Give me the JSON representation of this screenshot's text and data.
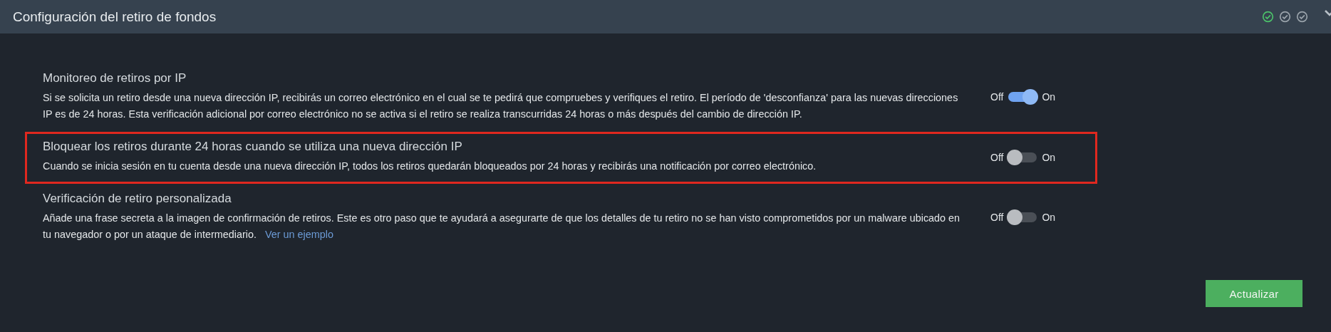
{
  "header": {
    "title": "Configuración del retiro de fondos",
    "steps": [
      {
        "complete": true
      },
      {
        "complete": false
      },
      {
        "complete": false
      }
    ]
  },
  "settings": [
    {
      "title": "Monitoreo de retiros por IP",
      "description": "Si se solicita un retiro desde una nueva dirección IP, recibirás un correo electrónico en el cual se te pedirá que compruebes y verifiques el retiro. El período de 'desconfianza' para las nuevas direcciones IP es de 24 horas. Esta verificación adicional por correo electrónico no se activa si el retiro se realiza transcurridas 24 horas o más después del cambio de dirección IP.",
      "off_label": "Off",
      "on_label": "On",
      "on": true,
      "highlighted": false
    },
    {
      "title": "Bloquear los retiros durante 24 horas cuando se utiliza una nueva dirección IP",
      "description": "Cuando se inicia sesión en tu cuenta desde una nueva dirección IP, todos los retiros quedarán bloqueados por 24 horas y recibirás una notificación por correo electrónico.",
      "off_label": "Off",
      "on_label": "On",
      "on": false,
      "highlighted": true
    },
    {
      "title": "Verificación de retiro personalizada",
      "description": "Añade una frase secreta a la imagen de confirmación de retiros. Este es otro paso que te ayudará a asegurarte de que los detalles de tu retiro no se han visto comprometidos por un malware ubicado en tu navegador o por un ataque de intermediario.",
      "link": "Ver un ejemplo",
      "off_label": "Off",
      "on_label": "On",
      "on": false,
      "highlighted": false
    }
  ],
  "submit": "Actualizar"
}
